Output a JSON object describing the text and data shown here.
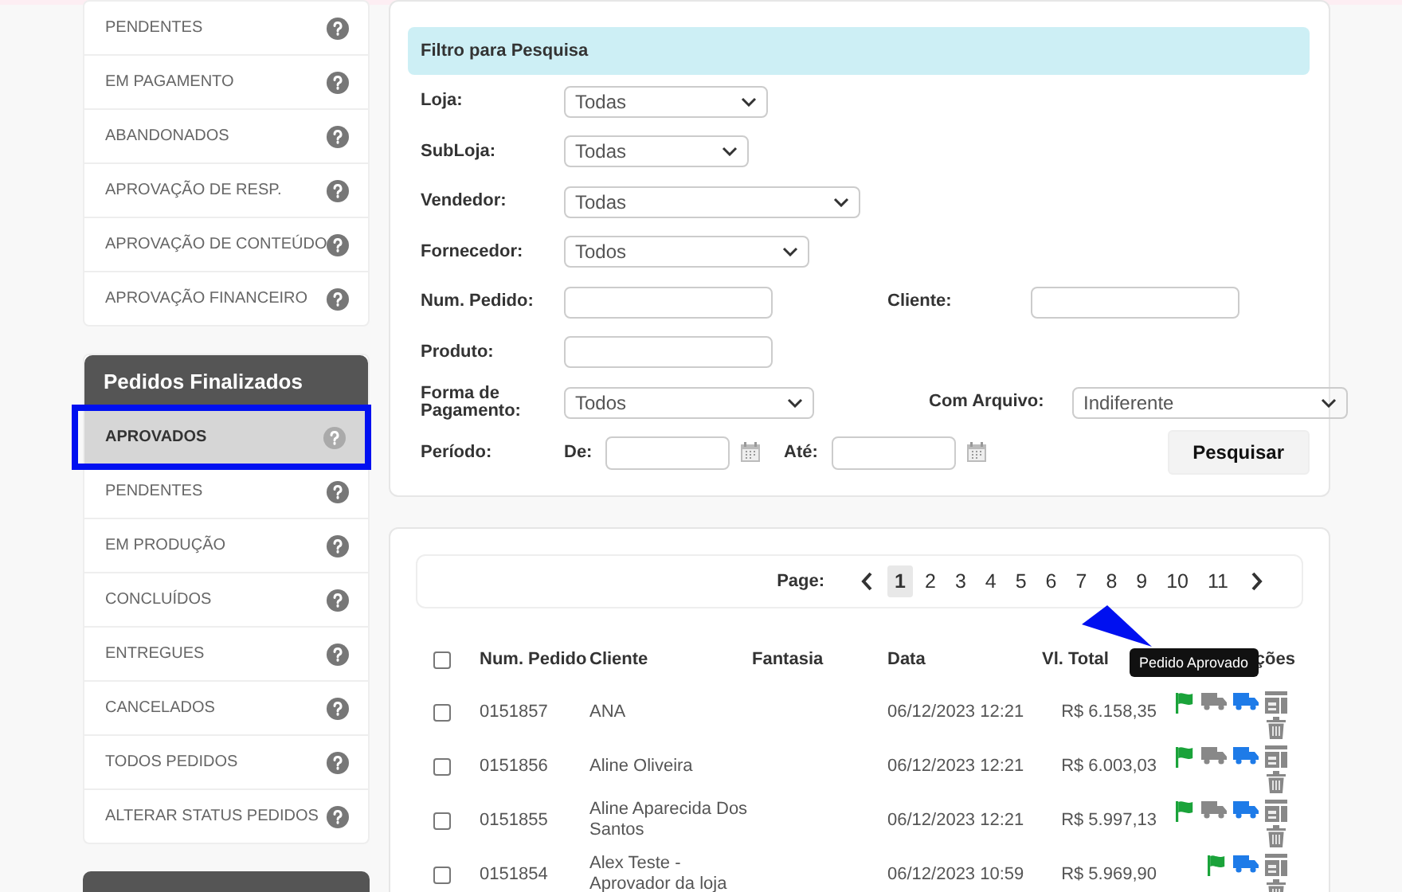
{
  "sidebar": {
    "groups": [
      {
        "items": [
          {
            "label": "PENDENTES",
            "selected": false
          },
          {
            "label": "EM PAGAMENTO",
            "selected": false
          },
          {
            "label": "ABANDONADOS",
            "selected": false
          },
          {
            "label": "APROVAÇÃO DE RESP.",
            "selected": false
          },
          {
            "label": "APROVAÇÃO DE CONTEÚDO",
            "selected": false
          },
          {
            "label": "APROVAÇÃO FINANCEIRO",
            "selected": false
          }
        ]
      },
      {
        "title": "Pedidos Finalizados",
        "items": [
          {
            "label": "APROVADOS",
            "selected": true
          },
          {
            "label": "PENDENTES",
            "selected": false
          },
          {
            "label": "EM PRODUÇÃO",
            "selected": false
          },
          {
            "label": "CONCLUÍDOS",
            "selected": false
          },
          {
            "label": "ENTREGUES",
            "selected": false
          },
          {
            "label": "CANCELADOS",
            "selected": false
          },
          {
            "label": "TODOS PEDIDOS",
            "selected": false
          },
          {
            "label": "ALTERAR STATUS PEDIDOS",
            "selected": false
          }
        ]
      }
    ]
  },
  "filter": {
    "title": "Filtro para Pesquisa",
    "rows": [
      [
        {
          "label": "Loja:",
          "kind": "select",
          "value": "Todas"
        }
      ],
      [
        {
          "label": "SubLoja:",
          "kind": "select",
          "value": "Todas"
        }
      ],
      [
        {
          "label": "Vendedor:",
          "kind": "select",
          "value": "Todas"
        }
      ],
      [
        {
          "label": "Fornecedor:",
          "kind": "select",
          "value": "Todos"
        }
      ],
      [
        {
          "label": "Num. Pedido:",
          "kind": "input"
        },
        {
          "label": "Cliente:",
          "kind": "input"
        }
      ],
      [
        {
          "label": "Produto:",
          "kind": "input"
        }
      ],
      [
        {
          "label": "Forma de Pagamento:",
          "kind": "select",
          "value": "Todos"
        },
        {
          "label": "Com Arquivo:",
          "kind": "select",
          "value": "Indiferente"
        }
      ]
    ],
    "period": {
      "label": "Período:",
      "from_label": "De:",
      "to_label": "Até:"
    },
    "button": "Pesquisar"
  },
  "pagination": {
    "label": "Page:",
    "pages": [
      {
        "label": "1",
        "selected": true
      },
      {
        "label": "2",
        "selected": false
      },
      {
        "label": "3",
        "selected": false
      },
      {
        "label": "4",
        "selected": false
      },
      {
        "label": "5",
        "selected": false
      },
      {
        "label": "6",
        "selected": false
      },
      {
        "label": "7",
        "selected": false
      },
      {
        "label": "8",
        "selected": false
      },
      {
        "label": "9",
        "selected": false
      },
      {
        "label": "10",
        "selected": false
      },
      {
        "label": "11",
        "selected": false
      }
    ]
  },
  "table": {
    "columns": [
      "Num. Pedido",
      "Cliente",
      "Fantasia",
      "Data",
      "Vl. Total",
      "ções"
    ],
    "select_all_checked": false,
    "rows": [
      {
        "checked": false,
        "number": "0151857",
        "client": "ANA",
        "date": "06/12/2023 12:21",
        "total": "R$ 6.158,35",
        "actions": [
          {
            "kind": "flag"
          },
          {
            "kind": "truck"
          },
          {
            "kind": "delivery"
          },
          {
            "kind": "report"
          },
          {
            "kind": "trash"
          }
        ]
      },
      {
        "checked": false,
        "number": "0151856",
        "client": "Aline Oliveira",
        "date": "06/12/2023 12:21",
        "total": "R$ 6.003,03",
        "actions": [
          {
            "kind": "flag"
          },
          {
            "kind": "truck"
          },
          {
            "kind": "delivery"
          },
          {
            "kind": "report"
          },
          {
            "kind": "trash"
          }
        ]
      },
      {
        "checked": false,
        "number": "0151855",
        "client": "Aline Aparecida Dos Santos",
        "date": "06/12/2023 12:21",
        "total": "R$ 5.997,13",
        "actions": [
          {
            "kind": "flag"
          },
          {
            "kind": "truck"
          },
          {
            "kind": "delivery"
          },
          {
            "kind": "report"
          },
          {
            "kind": "trash"
          }
        ]
      },
      {
        "checked": false,
        "number": "0151854",
        "client": "Alex Teste - Aprovador da loja",
        "date": "06/12/2023 10:59",
        "total": "R$ 5.969,90",
        "actions": [
          {
            "kind": "flag"
          },
          {
            "kind": "delivery"
          },
          {
            "kind": "report"
          },
          {
            "kind": "trash"
          }
        ]
      }
    ]
  },
  "tooltip": "Pedido Aprovado"
}
